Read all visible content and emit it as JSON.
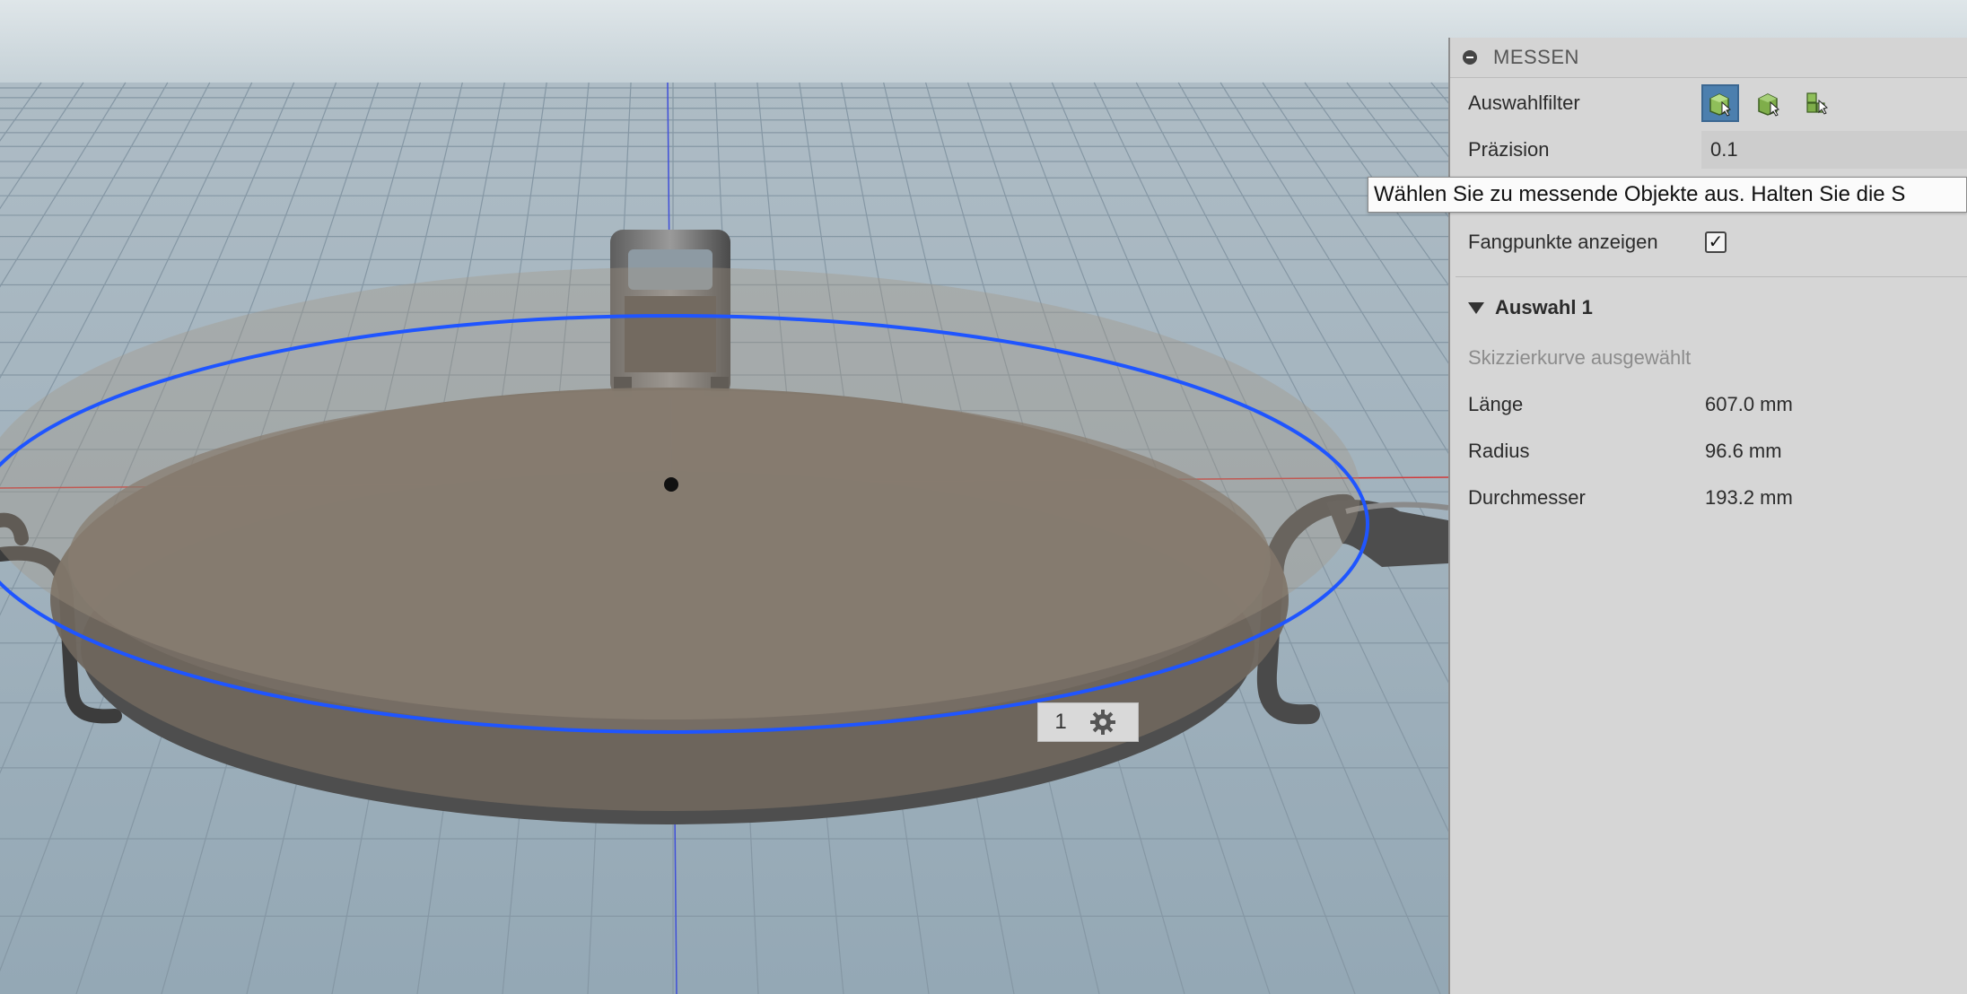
{
  "viewport": {
    "selection_count": "1",
    "colors": {
      "sky": "#d3dde1",
      "ground": "#9fb1bd",
      "grid_line": "#8597a4",
      "x_axis": "#d23a3a",
      "z_axis": "#3f4fd8",
      "selected_curve": "#1f55ff",
      "pan_fill": "#6f665d"
    }
  },
  "panel": {
    "title": "MESSEN",
    "selection_filter_label": "Auswahlfilter",
    "selection_filter_icons": [
      "select-body-icon",
      "select-face-icon",
      "select-component-icon"
    ],
    "precision_label": "Präzision",
    "precision_value": "0.1",
    "snap_points_label": "Fangpunkte anzeigen",
    "snap_points_checked": "✓",
    "section_title": "Auswahl 1",
    "selection_type": "Skizzierkurve ausgewählt",
    "results": [
      {
        "label": "Länge",
        "value": "607.0 mm"
      },
      {
        "label": "Radius",
        "value": "96.6 mm"
      },
      {
        "label": "Durchmesser",
        "value": "193.2 mm"
      }
    ]
  },
  "tooltip": {
    "text": "Wählen Sie zu messende Objekte aus. Halten Sie die S"
  }
}
